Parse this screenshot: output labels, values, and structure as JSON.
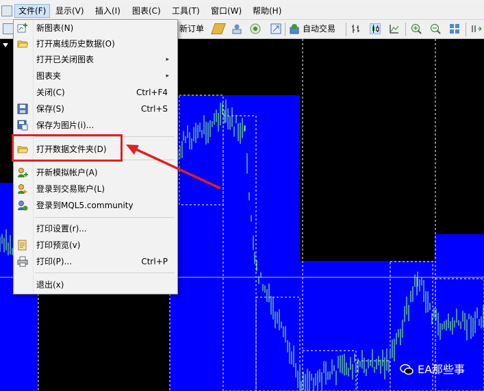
{
  "menubar": {
    "items": [
      {
        "label": "文件(F)"
      },
      {
        "label": "显示(V)"
      },
      {
        "label": "插入(I)"
      },
      {
        "label": "图表(C)"
      },
      {
        "label": "工具(T)"
      },
      {
        "label": "窗口(W)"
      },
      {
        "label": "帮助(H)"
      }
    ]
  },
  "toolbar": {
    "new_order_label": "新订单",
    "auto_trade_label": "自动交易"
  },
  "file_menu": {
    "items": [
      {
        "label": "新图表(N)",
        "shortcut": "",
        "icon": "new-chart-icon"
      },
      {
        "label": "打开离线历史数据(O)",
        "shortcut": "",
        "icon": "folder-icon"
      },
      {
        "label": "打开已关闭图表",
        "shortcut": "",
        "icon": "",
        "submenu": true
      },
      {
        "label": "图表夹",
        "shortcut": "",
        "icon": "",
        "submenu": true
      },
      {
        "label": "关闭(C)",
        "shortcut": "Ctrl+F4",
        "icon": ""
      },
      {
        "label": "保存(S)",
        "shortcut": "Ctrl+S",
        "icon": "save-icon"
      },
      {
        "label": "保存为图片(i)...",
        "shortcut": "",
        "icon": "save-picture-icon"
      },
      {
        "label": "打开数据文件夹(D)",
        "shortcut": "",
        "icon": "folder-icon"
      },
      {
        "label": "开新模拟帐户(A)",
        "shortcut": "",
        "icon": "add-user-icon"
      },
      {
        "label": "登录到交易账户(L)",
        "shortcut": "",
        "icon": "login-user-icon"
      },
      {
        "label": "登录到MQL5.community",
        "shortcut": "",
        "icon": "community-icon"
      },
      {
        "label": "打印设置(r)...",
        "shortcut": "",
        "icon": ""
      },
      {
        "label": "打印预览(v)",
        "shortcut": "",
        "icon": "print-preview-icon"
      },
      {
        "label": "打印(P)...",
        "shortcut": "Ctrl+P",
        "icon": "printer-icon"
      },
      {
        "label": "退出(x)",
        "shortcut": "",
        "icon": ""
      }
    ]
  },
  "watermark": {
    "text": "EA那些事"
  },
  "colors": {
    "chart_background": "#000000",
    "box_fill": "#0000ff",
    "candle_color": "#7cf07c",
    "highlight_border": "#e02020",
    "arrow_color": "#e02020"
  }
}
